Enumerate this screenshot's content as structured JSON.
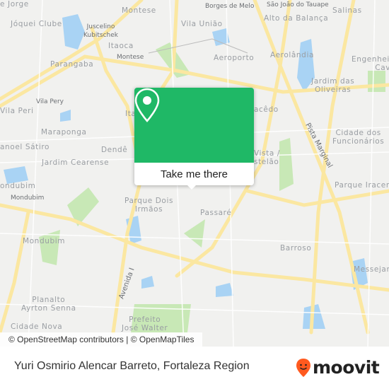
{
  "map": {
    "labels": {
      "jorge": "e Jorge",
      "joquei": "Jóquei Clube",
      "juscelino": "Juscelino\nKubitschek",
      "montese_top": "Montese",
      "borges": "Borges de Melo",
      "sao_joao": "São João do Tauape",
      "salinas": "Salinas",
      "alto": "Alto da Balança",
      "vila_uniao": "Vila União",
      "itaoca": "Itaoca",
      "montese_small": "Montese",
      "aeroporto": "Aeroporto",
      "aerolandia": "Aerolândia",
      "engenheiro": "Engenheiro\nCaval",
      "parangaba": "Parangaba",
      "jardim_oliveiras": "Jardim das\nOliveiras",
      "vila_pery": "Vila Pery",
      "vila_peri": "Vila Peri",
      "ita": "Ita",
      "macedo": "acêdo",
      "maraponga": "Maraponga",
      "pista": "Pista Marginal",
      "cidade_func": "Cidade dos\nFuncionários",
      "manoel": "anoel Sátiro",
      "dende": "Dendê",
      "vista": "Vista /\nstelão",
      "jardim_cearense": "Jardim Cearense",
      "mondubim1": "ondubim",
      "mondubim_small": "Mondubim",
      "parque_iracema": "Parque Iracem",
      "parque_dois": "Parque Dois\nIrmãos",
      "passare": "Passaré",
      "mondubim2": "Mondubim",
      "barroso": "Barroso",
      "messejana": "Messejan",
      "avenida": "Avenida I",
      "planalto": "Planalto\nAyrton Senna",
      "prefeito": "Prefeito\nJosé Walter",
      "cidade_nova": "Cidade Nova"
    },
    "colors": {
      "land": "#f1f1ef",
      "road": "#fbe7a1",
      "water": "#a9d3f4",
      "park": "#c8e8b6"
    }
  },
  "popup": {
    "icon": "map-pin-icon",
    "button_label": "Take me there",
    "color": "#1fb866"
  },
  "attribution": "© OpenStreetMap contributors | © OpenMapTiles",
  "footer": {
    "title": "Yuri Osmirio Alencar Barreto, Fortaleza Region",
    "logo": "moovit",
    "logo_color": "#ff5a1f"
  }
}
